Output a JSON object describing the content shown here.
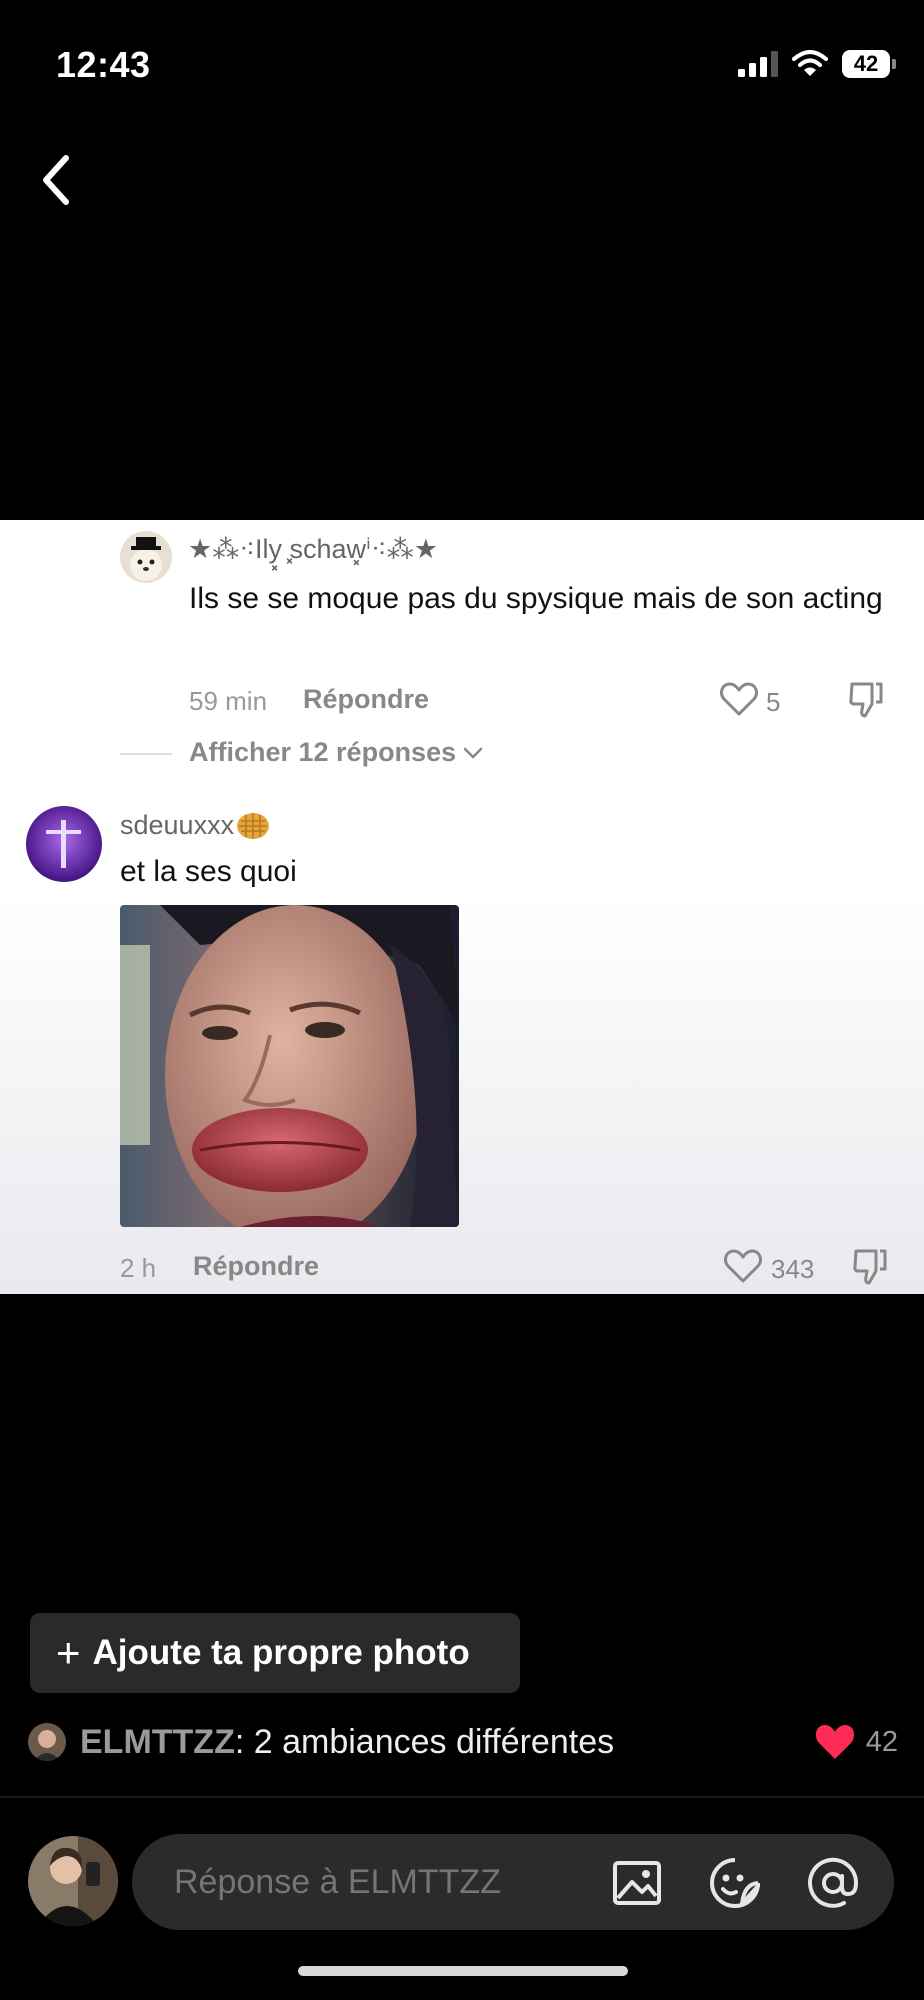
{
  "status_bar": {
    "time": "12:43",
    "battery": "42"
  },
  "comments": [
    {
      "username": "★⁂⁖Ily͓ ͓schaw͓ⁱ⁖⁂★",
      "text": "Ils se se moque pas du spysique mais de son acting",
      "time": "59 min",
      "reply_label": "Répondre",
      "likes": "5",
      "view_replies_label": "Afficher 12 réponses"
    },
    {
      "username": "sdeuuxxx",
      "text": "et la ses quoi",
      "time": "2 h",
      "reply_label": "Répondre",
      "likes": "343"
    }
  ],
  "bottom": {
    "add_photo_label": "Ajoute ta propre photo",
    "caption_user": "ELMTTZZ",
    "caption_text": ": 2 ambiances différentes",
    "caption_likes": "42",
    "input_placeholder": "Réponse à ELMTTZZ"
  },
  "colors": {
    "like_red": "#fe2c55",
    "card_bg": "#ffffff"
  }
}
